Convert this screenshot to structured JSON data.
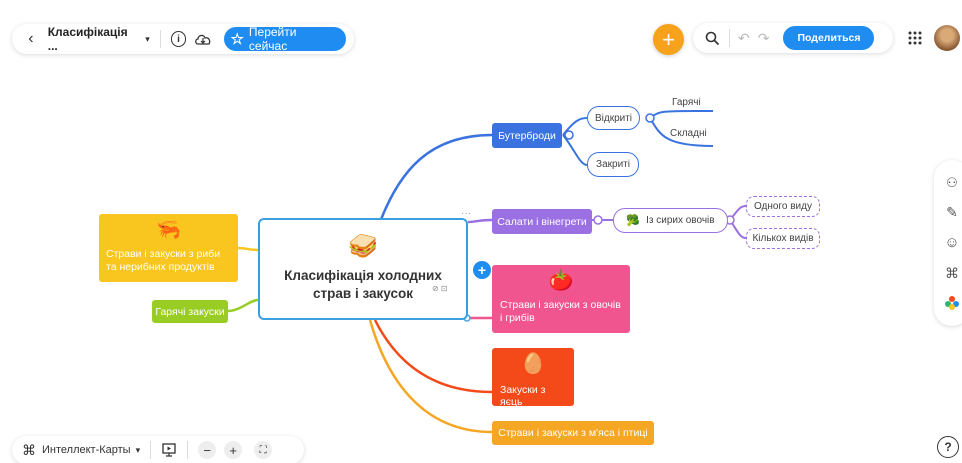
{
  "toolbar": {
    "back_label": "‹",
    "doc_title": "Класифікація ...",
    "go_now_label": "Перейти сейчас",
    "share_label": "Поделиться"
  },
  "map": {
    "center": "Класифікація холодних страв і закусок",
    "branches": {
      "sandwiches": "Бутерброди",
      "open": "Відкриті",
      "hot": "Гарячі",
      "complex": "Складні",
      "closed": "Закриті",
      "salads": "Салати і вінегрети",
      "raw_veg": "Із сирих овочів",
      "one_kind": "Одного виду",
      "many_kinds": "Кількох видів",
      "veg_mushroom": "Страви і закуски з овочів і грибів",
      "eggs": "Закуски з яєць",
      "meat": "Страви і закуски з м'яса і птиці",
      "fish": "Страви і закуски з риби та нерибних продуктів",
      "hot_snacks": "Гарячі закуски"
    }
  },
  "bottom": {
    "mode_label": "Интеллект-Карты",
    "help": "?"
  },
  "colors": {
    "accent": "#1f8cf1",
    "add": "#f7a21b",
    "blue_branch": "#3a73e0",
    "purple_branch": "#9b70e3",
    "pink_branch": "#f0558f",
    "red_branch": "#f44a1a",
    "orange_branch": "#f5a623",
    "yellow_branch": "#f9c51f",
    "green_branch": "#9acd24"
  }
}
